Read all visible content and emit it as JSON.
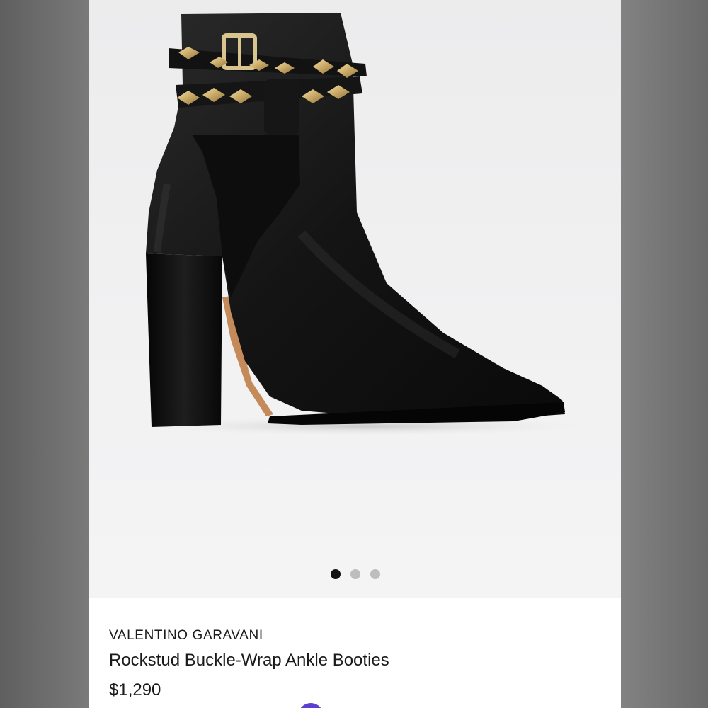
{
  "product": {
    "brand": "VALENTINO GARAVANI",
    "title": "Rockstud Buckle-Wrap Ankle Booties",
    "price": "$1,290"
  },
  "gallery": {
    "image_icon": "black-ankle-bootie-image",
    "image_count": 3,
    "active_index": 0
  },
  "colors": {
    "page_background": "#ffffff",
    "gallery_background": "#f0f0f1",
    "dot_active": "#111111",
    "dot_inactive": "#bdbdbd",
    "fab": "#5a3fd0"
  }
}
